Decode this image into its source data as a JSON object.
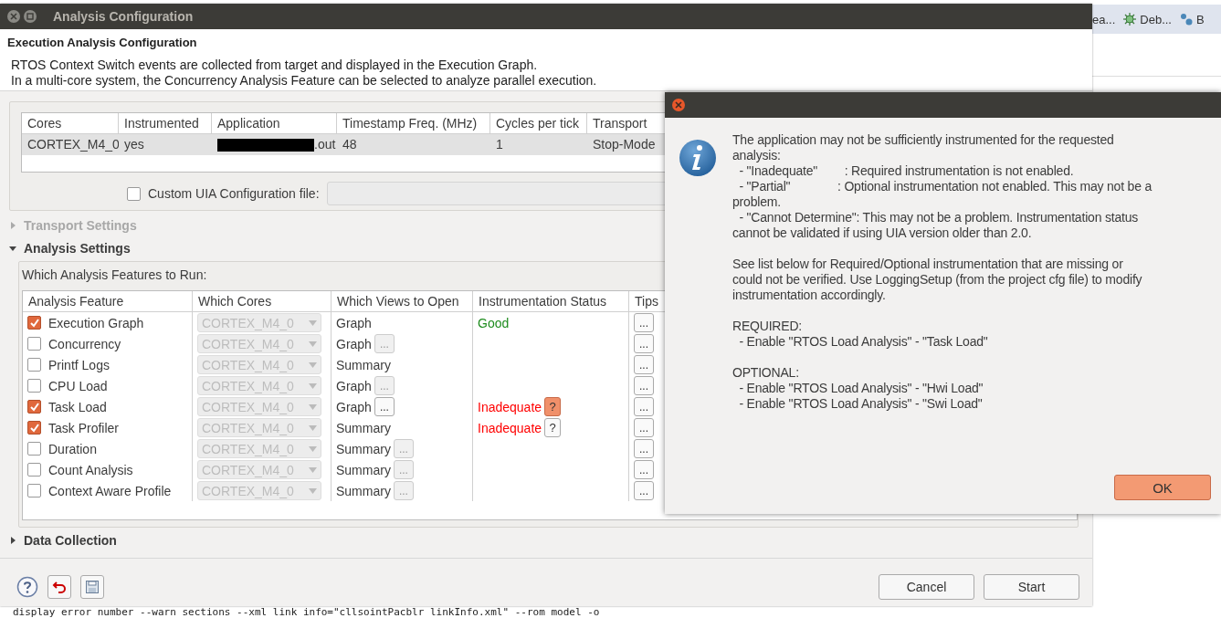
{
  "background": {
    "toolbar": [
      {
        "label": "ea...",
        "kind": "text"
      },
      {
        "label": "Deb...",
        "kind": "debug"
      },
      {
        "label": "B",
        "kind": "nodes"
      }
    ],
    "console_line": "display error number --warn sections --xml link info=\"cllsointPacblr linkInfo.xml\" --rom model -o"
  },
  "dialog": {
    "title": "Analysis Configuration",
    "heading": "Execution Analysis Configuration",
    "description": [
      "RTOS Context Switch events are collected from target and displayed in the Execution Graph.",
      "In a multi-core system, the Concurrency Analysis Feature can be selected to analyze parallel execution."
    ],
    "cores_table": {
      "columns": [
        "Cores",
        "Instrumented",
        "Application",
        "Timestamp Freq. (MHz)",
        "Cycles per tick",
        "Transport"
      ],
      "rows": [
        {
          "selected": true,
          "cells": [
            "CORTEX_M4_0",
            "yes",
            ".out",
            "48",
            "1",
            "Stop-Mode"
          ],
          "redacted": true
        }
      ]
    },
    "custom_uia": {
      "label": "Custom UIA Configuration file:",
      "checked": false
    },
    "sections": [
      {
        "title": "Transport Settings",
        "expanded": false,
        "disabled": true
      },
      {
        "title": "Analysis Settings",
        "expanded": true,
        "disabled": false
      }
    ],
    "features_label": "Which Analysis Features to Run:",
    "features_table": {
      "columns": [
        "Analysis Feature",
        "Which Cores",
        "Which Views to Open",
        "Instrumentation Status",
        "Tips"
      ],
      "rows": [
        {
          "name": "Execution Graph",
          "checked": true,
          "core": "CORTEX_M4_0",
          "view": "Graph",
          "status": {
            "text": "Good",
            "kind": "good"
          },
          "tips": "..."
        },
        {
          "name": "Concurrency",
          "checked": false,
          "core": "CORTEX_M4_0",
          "view": "Graph",
          "view_button": {
            "label": "...",
            "disabled": true
          },
          "tips": "..."
        },
        {
          "name": "Printf Logs",
          "checked": false,
          "core": "CORTEX_M4_0",
          "view": "Summary",
          "tips": "..."
        },
        {
          "name": "CPU Load",
          "checked": false,
          "core": "CORTEX_M4_0",
          "view": "Graph",
          "view_button": {
            "label": "...",
            "disabled": true
          },
          "tips": "..."
        },
        {
          "name": "Task Load",
          "checked": true,
          "core": "CORTEX_M4_0",
          "view": "Graph",
          "view_button": {
            "label": "...",
            "disabled": false
          },
          "status": {
            "text": "Inadequate",
            "kind": "bad"
          },
          "help": {
            "label": "?",
            "highlighted": true
          },
          "tips": "..."
        },
        {
          "name": "Task Profiler",
          "checked": true,
          "core": "CORTEX_M4_0",
          "view": "Summary",
          "status": {
            "text": "Inadequate",
            "kind": "bad"
          },
          "help": {
            "label": "?",
            "highlighted": false
          },
          "tips": "..."
        },
        {
          "name": "Duration",
          "checked": false,
          "core": "CORTEX_M4_0",
          "view": "Summary",
          "view_button": {
            "label": "...",
            "disabled": true
          },
          "tips": "..."
        },
        {
          "name": "Count Analysis",
          "checked": false,
          "core": "CORTEX_M4_0",
          "view": "Summary",
          "view_button": {
            "label": "...",
            "disabled": true
          },
          "tips": "..."
        },
        {
          "name": "Context Aware Profile",
          "checked": false,
          "core": "CORTEX_M4_0",
          "view": "Summary",
          "view_button": {
            "label": "...",
            "disabled": true
          },
          "tips": "..."
        }
      ]
    },
    "data_collection": {
      "title": "Data Collection",
      "expanded": false
    },
    "buttons": [
      "Cancel",
      "Start"
    ]
  },
  "message": {
    "paragraphs": [
      [
        "The application may not be sufficiently instrumented for the requested",
        "analysis:",
        "  - \"Inadequate\"        : Required instrumentation is not enabled.",
        "  - \"Partial\"              : Optional instrumentation not enabled. This may not be a",
        "problem.",
        "  - \"Cannot Determine\": This may not be a problem. Instrumentation status",
        "cannot be validated if using UIA version older than 2.0."
      ],
      [
        "See list below for Required/Optional instrumentation that are missing or",
        "could not be verified. Use LoggingSetup (from the project cfg file) to modify",
        "instrumentation accordingly."
      ],
      [
        "REQUIRED:",
        "  - Enable \"RTOS Load Analysis\" - \"Task Load\""
      ],
      [
        "OPTIONAL:",
        "  - Enable \"RTOS Load Analysis\" - \"Hwi Load\"",
        "  - Enable \"RTOS Load Analysis\" - \"Swi Load\""
      ]
    ],
    "button": "OK"
  }
}
